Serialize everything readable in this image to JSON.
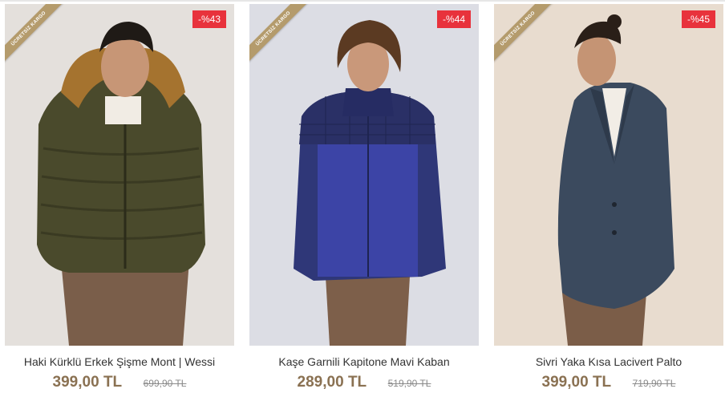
{
  "products": [
    {
      "ribbon": "ÜCRETSİZ KARGO",
      "discount": "-%43",
      "title": "Haki Kürklü Erkek Şişme Mont | Wessi",
      "price": "399,00 TL",
      "old_price": "699,90 TL",
      "colors": {
        "background": "#e4e0dc",
        "jacket": "#4a4a2c",
        "trousers": "#7a5e4a"
      }
    },
    {
      "ribbon": "ÜCRETSİZ KARGO",
      "discount": "-%44",
      "title": "Kaşe Garnili Kapitone Mavi Kaban",
      "price": "289,00 TL",
      "old_price": "519,90 TL",
      "colors": {
        "background": "#dcdde4",
        "jacket": "#2f3778",
        "trousers": "#7d5f4a"
      }
    },
    {
      "ribbon": "ÜCRETSİZ KARGO",
      "discount": "-%45",
      "title": "Sivri Yaka Kısa Lacivert Palto",
      "price": "399,00 TL",
      "old_price": "719,90 TL",
      "colors": {
        "background": "#e8dccf",
        "jacket": "#3b4a5e",
        "trousers": "#7b5d48"
      }
    }
  ],
  "colors": {
    "accent": "#8a7152",
    "badge": "#e8323c",
    "ribbon": "#b49b6c"
  }
}
